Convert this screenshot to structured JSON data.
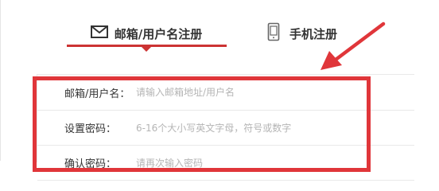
{
  "tabs": [
    {
      "label": "邮箱/用户名注册",
      "icon": "envelope-icon",
      "active": true
    },
    {
      "label": "手机注册",
      "icon": "mobile-phone-icon",
      "active": false
    }
  ],
  "form": {
    "rows": [
      {
        "label": "邮箱/用户名：",
        "placeholder": "请输入邮箱地址/用户名"
      },
      {
        "label": "设置密码：",
        "placeholder": "6-16个大小写英文字母，符号或数字"
      },
      {
        "label": "确认密码：",
        "placeholder": "请再次输入密码"
      }
    ]
  },
  "colors": {
    "accent": "#cc3333",
    "annotation": "#e0363a"
  }
}
